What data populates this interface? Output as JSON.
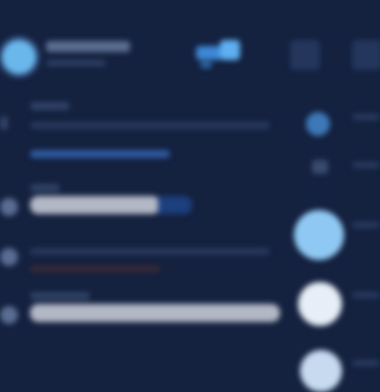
{
  "header": {
    "name": "",
    "subtitle": ""
  },
  "colors": {
    "background": "#14213f",
    "accent": "#5fb0f2",
    "bar_fill": "#b3b8c6",
    "bar_end": "#1c3f7e",
    "avatar": "#6ab7ec"
  },
  "icons": [
    "chat-icon",
    "menu-icon"
  ],
  "rows": [
    {
      "progress": 0.8
    },
    {
      "progress": 1.0
    }
  ]
}
